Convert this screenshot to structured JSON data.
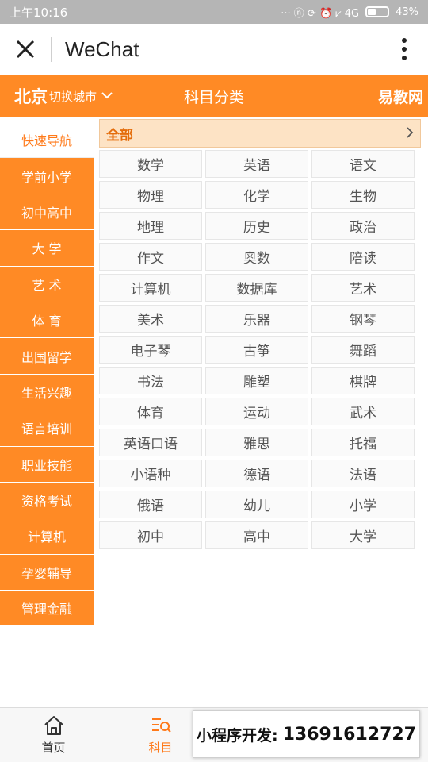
{
  "status_bar": {
    "time": "上午10:16",
    "icons": "··· ⓝ ⟳ ⏰ ⩗ 4G",
    "battery": "43%"
  },
  "window": {
    "title": "WeChat"
  },
  "top_nav": {
    "city": "北京",
    "switch_city": "切换城市",
    "title": "科目分类",
    "brand": "易教网"
  },
  "sidebar": {
    "items": [
      {
        "label": "快速导航",
        "active": true
      },
      {
        "label": "学前小学"
      },
      {
        "label": "初中高中"
      },
      {
        "label": "大 学"
      },
      {
        "label": "艺 术"
      },
      {
        "label": "体 育"
      },
      {
        "label": "出国留学"
      },
      {
        "label": "生活兴趣"
      },
      {
        "label": "语言培训"
      },
      {
        "label": "职业技能"
      },
      {
        "label": "资格考试"
      },
      {
        "label": "计算机"
      },
      {
        "label": "孕婴辅导"
      },
      {
        "label": "管理金融"
      }
    ]
  },
  "content": {
    "all_label": "全部",
    "subjects": [
      "数学",
      "英语",
      "语文",
      "物理",
      "化学",
      "生物",
      "地理",
      "历史",
      "政治",
      "作文",
      "奥数",
      "陪读",
      "计算机",
      "数据库",
      "艺术",
      "美术",
      "乐器",
      "钢琴",
      "电子琴",
      "古筝",
      "舞蹈",
      "书法",
      "雕塑",
      "棋牌",
      "体育",
      "运动",
      "武术",
      "英语口语",
      "雅思",
      "托福",
      "小语种",
      "德语",
      "法语",
      "俄语",
      "幼儿",
      "小学",
      "初中",
      "高中",
      "大学"
    ]
  },
  "tab_bar": {
    "tabs": [
      {
        "label": "首页",
        "icon": "home-icon"
      },
      {
        "label": "科目",
        "icon": "subject-list-icon",
        "active": true
      }
    ]
  },
  "promo": {
    "text": "小程序开发:",
    "phone": "13691612727"
  },
  "colors": {
    "accent": "#ff8a25",
    "active_text": "#ff7a1a",
    "all_bg": "#fde3c5"
  }
}
